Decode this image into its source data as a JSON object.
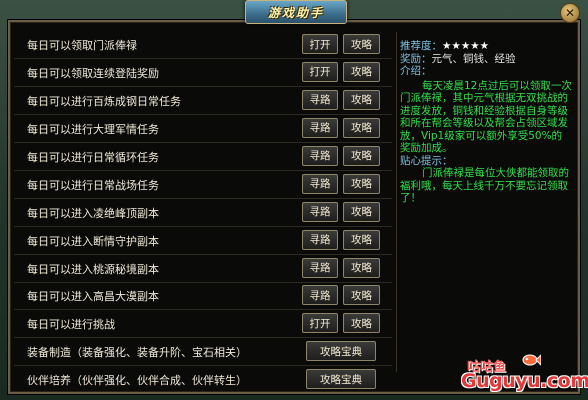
{
  "window": {
    "title": "游戏助手",
    "close_icon": "close-icon"
  },
  "tasks": [
    {
      "label": "每日可以领取门派俸禄",
      "buttons": [
        "打开",
        "攻略"
      ]
    },
    {
      "label": "每日可以领取连续登陆奖励",
      "buttons": [
        "打开",
        "攻略"
      ]
    },
    {
      "label": "每日可以进行百炼成钢日常任务",
      "buttons": [
        "寻路",
        "攻略"
      ]
    },
    {
      "label": "每日可以进行大理军情任务",
      "buttons": [
        "寻路",
        "攻略"
      ]
    },
    {
      "label": "每日可以进行日常循环任务",
      "buttons": [
        "寻路",
        "攻略"
      ]
    },
    {
      "label": "每日可以进行日常战场任务",
      "buttons": [
        "寻路",
        "攻略"
      ]
    },
    {
      "label": "每日可以进入凌绝峰顶副本",
      "buttons": [
        "寻路",
        "攻略"
      ]
    },
    {
      "label": "每日可以进入断情守护副本",
      "buttons": [
        "寻路",
        "攻略"
      ]
    },
    {
      "label": "每日可以进入桃源秘境副本",
      "buttons": [
        "寻路",
        "攻略"
      ]
    },
    {
      "label": "每日可以进入高昌大漠副本",
      "buttons": [
        "寻路",
        "攻略"
      ]
    },
    {
      "label": "每日可以进行挑战",
      "buttons": [
        "打开",
        "攻略"
      ]
    }
  ],
  "guides": [
    {
      "label": "装备制造（装备强化、装备升阶、宝石相关）",
      "button": "攻略宝典"
    },
    {
      "label": "伙伴培养（伙伴强化、伙伴合成、伙伴转生）",
      "button": "攻略宝典"
    }
  ],
  "info": {
    "recommend_label": "推荐度：",
    "stars": "★★★★★",
    "reward_label": "奖励：",
    "reward_value": "元气、铜钱、经验",
    "intro_label": "介绍：",
    "intro_text": "每天凌晨12点过后可以领取一次门派俸禄，其中元气根据无双挑战的进度发放，铜钱和经验根据自身等级和所在帮会等级以及帮会占领区域发放，Vip1级家可以额外享受50%的奖励加成。",
    "tip_label": "贴心提示：",
    "tip_text": "门派俸禄是每位大侠都能领取的福利哦，每天上线千万不要忘记领取了！"
  },
  "watermark": {
    "cn": "咕咕鱼",
    "en": "Guguyu.com"
  },
  "colors": {
    "accent_text": "#2ee04a",
    "label_blue": "#7ec1e0",
    "border": "#8f8667"
  }
}
